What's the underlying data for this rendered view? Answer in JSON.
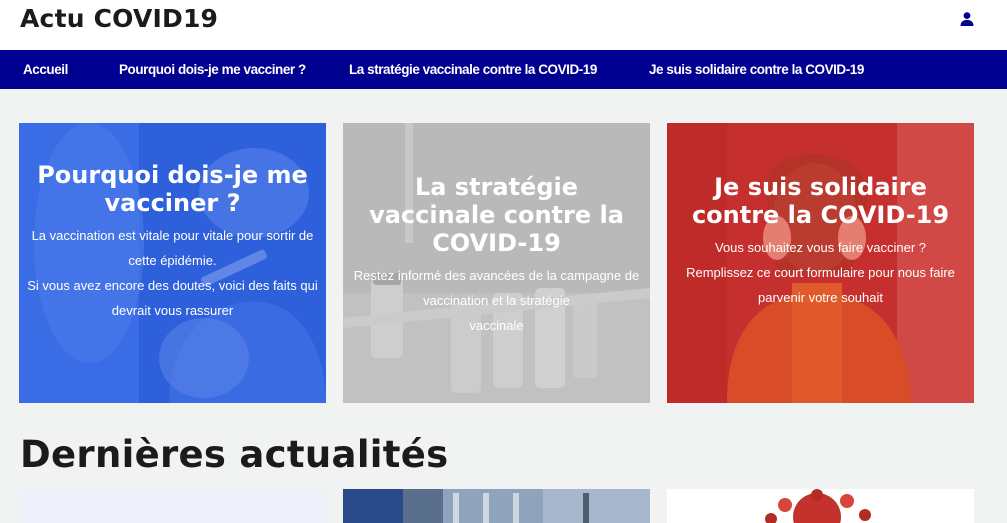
{
  "header": {
    "site_title": "Actu COVID19"
  },
  "nav": {
    "items": [
      {
        "label": "Accueil"
      },
      {
        "label": "Pourquoi dois-je me vacciner ?"
      },
      {
        "label": "La stratégie vaccinale contre la COVID-19"
      },
      {
        "label": "Je suis solidaire contre la COVID-19"
      }
    ]
  },
  "cards": [
    {
      "title": "Pourquoi dois-je me vacciner ?",
      "body": [
        "La vaccination est vitale pour vitale pour sortir de",
        "cette épidémie.",
        "Si vous avez encore des doutes, voici des faits qui",
        "devrait vous rassurer"
      ]
    },
    {
      "title": "La stratégie vaccinale contre la COVID-19",
      "body": [
        "Restez informé des avancées de la campagne de",
        "vaccination et la stratégie",
        "vaccinale"
      ]
    },
    {
      "title": "Je suis solidaire contre la COVID-19",
      "body": [
        "Vous souhaitez vous faire vacciner ?",
        "Remplissez ce court formulaire pour nous faire",
        "parvenir votre souhait"
      ]
    }
  ],
  "news": {
    "section_title": "Dernières actualités"
  },
  "colors": {
    "nav_bg": "#000091",
    "card1_overlay": "#1a4fe0",
    "card2_overlay": "#b4b4b4",
    "card3_overlay": "#c62a2a"
  },
  "icons": {
    "user": "user-icon"
  }
}
